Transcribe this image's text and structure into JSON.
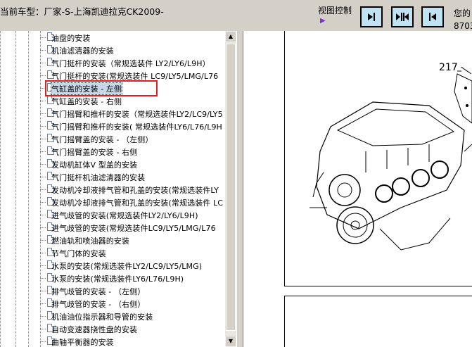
{
  "header": {
    "title": "当前车型：厂家-S-上海凯迪拉克CK2009-",
    "view_control_label": "视图控制",
    "view_control_arrow": "▶",
    "corner_text_1": "您的",
    "corner_text_2": "8703"
  },
  "tree": {
    "items": [
      {
        "label": "油盘的安装"
      },
      {
        "label": "机油滤清器的安装"
      },
      {
        "label": "气门挺杆的安装（常规选装件 LY2/LY6/L9H）"
      },
      {
        "label": "气门挺杆的安装(常规选装件 LC9/LY5/LMG/L76"
      },
      {
        "label": "气缸盖的安装 - 左侧",
        "selected": true
      },
      {
        "label": "气缸盖的安装 - 右侧"
      },
      {
        "label": "气门摇臂和推杆的安装（常规选装件LY2/LC9/LY5"
      },
      {
        "label": "气门摇臂和推杆的安装( 常规选装件LY6/L76/L9H"
      },
      {
        "label": "气门摇臂盖的安装 - （左侧）"
      },
      {
        "label": "气门摇臂盖的安装 - 右侧"
      },
      {
        "label": "发动机缸体V 型盖的安装"
      },
      {
        "label": "气门挺杆机油滤清器的安装"
      },
      {
        "label": "发动机冷却液排气管和孔盖的安装(常规选装件LY"
      },
      {
        "label": "发动机冷却液排气管和孔盖的安装(常规选装件 LC"
      },
      {
        "label": "进气歧管的安装(常规选装件LY2/LY6/L9H)"
      },
      {
        "label": "进气歧管的安装(常规选装件LC9/LY5/LMG/L76"
      },
      {
        "label": "燃油轨和喷油器的安装"
      },
      {
        "label": "节气门体的安装"
      },
      {
        "label": "水泵的安装(常规选装件LY2/LC9/LY5/LMG)"
      },
      {
        "label": "水泵的安装(常规选装件LY6/L76/L9H)"
      },
      {
        "label": "排气歧管的安装 - （左侧）"
      },
      {
        "label": "排气歧管的安装 - （右侧）"
      },
      {
        "label": "机油油位指示器和导管的安装"
      },
      {
        "label": "自动变速器挠性盘的安装"
      },
      {
        "label": "曲轴平衡器的安装"
      }
    ]
  },
  "diagram": {
    "callout": "217"
  },
  "colors": {
    "toolbar": "#d4d0c8",
    "button_bg": "#bfe3f3",
    "highlight": "#e02020"
  }
}
